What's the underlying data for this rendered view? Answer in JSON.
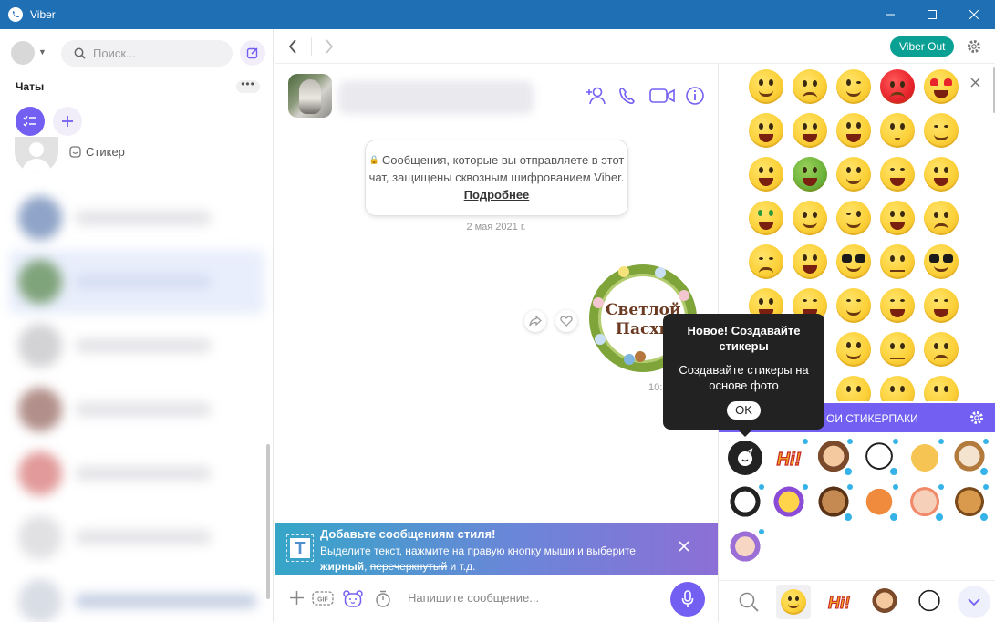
{
  "window": {
    "title": "Viber",
    "colors": {
      "titlebar": "#1f6fb5",
      "accent": "#7360f2",
      "viber_out": "#0aa194"
    }
  },
  "sidebar": {
    "search_placeholder": "Поиск...",
    "chats_label": "Чаты",
    "more_label": "•••",
    "sticker_chat_preview": "Стикер"
  },
  "navbar": {
    "viber_out_label": "Viber Out"
  },
  "chat": {
    "encryption_note": "Сообщения, которые вы отправляете в этот чат, защищены сквозным шифрованием Viber.",
    "encryption_more": "Подробнее",
    "date": "2 мая 2021 г.",
    "sticker_text_line1": "Светлой",
    "sticker_text_line2": "Пасхи",
    "message_time": "10:"
  },
  "tooltip": {
    "title": "Новое! Создавайте стикеры",
    "body": "Создавайте стикеры на основе фото",
    "ok_label": "OK"
  },
  "format_banner": {
    "icon_letter": "T",
    "title": "Добавьте сообщениям стиля!",
    "text_prefix": "Выделите текст, нажмите на правую кнопку мыши и выберите",
    "bold_word": "жирный",
    "separator": ",",
    "strike_word": "перечеркнутый",
    "text_suffix": "и т.д."
  },
  "composer": {
    "placeholder": "Напишите сообщение..."
  },
  "sticker_panel": {
    "my_packs_label": "ОИ СТИКЕРПАКИ",
    "hi_label": "Hi!",
    "icons": [
      "search-icon",
      "smiley-icon",
      "hi-sticker-icon",
      "boy-sticker-icon",
      "dalmatian-sticker-icon",
      "chevron-down-icon"
    ]
  }
}
